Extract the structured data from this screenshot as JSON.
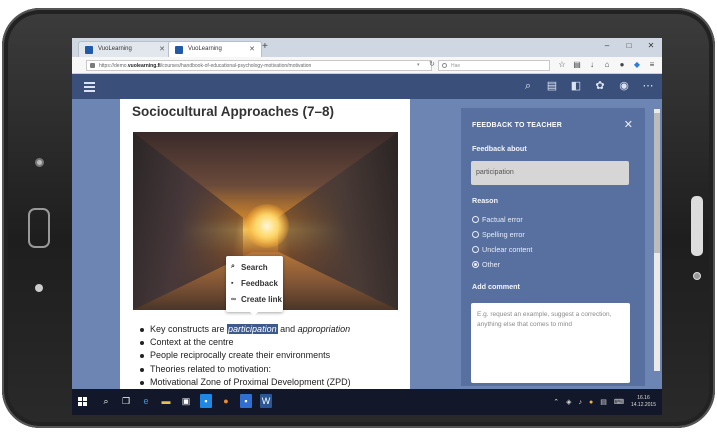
{
  "browser": {
    "tabs": [
      {
        "label": "VuoLearning",
        "active": false
      },
      {
        "label": "VuoLearning",
        "active": true
      }
    ],
    "new_tab_glyph": "+",
    "window_controls": [
      "–",
      "□",
      "✕"
    ],
    "url_prefix": "https://demo.",
    "url_domain": "vuolearning.fi",
    "url_path": "/courses/handbook-of-educational-psychology-motivation/motivation",
    "search_placeholder": "Hae",
    "toolbar_icons": [
      "star-icon",
      "reading-list-icon",
      "download-icon",
      "home-icon",
      "account-icon",
      "extension-icon",
      "menu-icon"
    ]
  },
  "app": {
    "header_icons": [
      "search-icon",
      "notes-icon",
      "feedback-icon",
      "settings-icon",
      "user-icon",
      "more-icon"
    ]
  },
  "page": {
    "title": "Sociocultural Approaches (7–8)",
    "context_menu": [
      {
        "label": "Search",
        "icon": "search-icon"
      },
      {
        "label": "Feedback",
        "icon": "feedback-icon"
      },
      {
        "label": "Create link",
        "icon": "link-icon"
      }
    ],
    "bullet1": {
      "prefix": "Key constructs are ",
      "highlight": "participation",
      "middle": " and ",
      "italic": "appropriation"
    },
    "bullets": [
      "Context at the centre",
      "People reciprocally create their environments",
      "Theories related to motivation:",
      "Motivational Zone of Proximal Development (ZPD)"
    ]
  },
  "feedback": {
    "title": "FEEDBACK TO TEACHER",
    "about_label": "Feedback about",
    "about_value": "participation",
    "reason_label": "Reason",
    "reasons": [
      {
        "label": "Factual error",
        "selected": false
      },
      {
        "label": "Spelling error",
        "selected": false
      },
      {
        "label": "Unclear content",
        "selected": false
      },
      {
        "label": "Other",
        "selected": true
      }
    ],
    "comment_label": "Add comment",
    "comment_placeholder": "E.g. request an example, suggest a correction, anything else that comes to mind"
  },
  "taskbar": {
    "time": "16.16",
    "date": "14.12.2015"
  }
}
